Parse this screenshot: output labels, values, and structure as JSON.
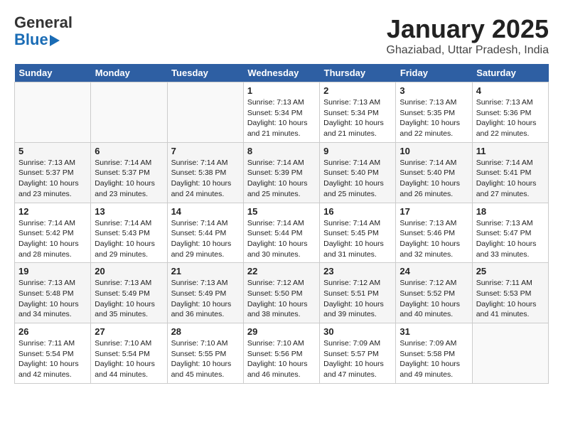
{
  "header": {
    "logo_general": "General",
    "logo_blue": "Blue",
    "month_title": "January 2025",
    "location": "Ghaziabad, Uttar Pradesh, India"
  },
  "days_of_week": [
    "Sunday",
    "Monday",
    "Tuesday",
    "Wednesday",
    "Thursday",
    "Friday",
    "Saturday"
  ],
  "weeks": [
    [
      {
        "day": "",
        "info": ""
      },
      {
        "day": "",
        "info": ""
      },
      {
        "day": "",
        "info": ""
      },
      {
        "day": "1",
        "info": "Sunrise: 7:13 AM\nSunset: 5:34 PM\nDaylight: 10 hours\nand 21 minutes."
      },
      {
        "day": "2",
        "info": "Sunrise: 7:13 AM\nSunset: 5:34 PM\nDaylight: 10 hours\nand 21 minutes."
      },
      {
        "day": "3",
        "info": "Sunrise: 7:13 AM\nSunset: 5:35 PM\nDaylight: 10 hours\nand 22 minutes."
      },
      {
        "day": "4",
        "info": "Sunrise: 7:13 AM\nSunset: 5:36 PM\nDaylight: 10 hours\nand 22 minutes."
      }
    ],
    [
      {
        "day": "5",
        "info": "Sunrise: 7:13 AM\nSunset: 5:37 PM\nDaylight: 10 hours\nand 23 minutes."
      },
      {
        "day": "6",
        "info": "Sunrise: 7:14 AM\nSunset: 5:37 PM\nDaylight: 10 hours\nand 23 minutes."
      },
      {
        "day": "7",
        "info": "Sunrise: 7:14 AM\nSunset: 5:38 PM\nDaylight: 10 hours\nand 24 minutes."
      },
      {
        "day": "8",
        "info": "Sunrise: 7:14 AM\nSunset: 5:39 PM\nDaylight: 10 hours\nand 25 minutes."
      },
      {
        "day": "9",
        "info": "Sunrise: 7:14 AM\nSunset: 5:40 PM\nDaylight: 10 hours\nand 25 minutes."
      },
      {
        "day": "10",
        "info": "Sunrise: 7:14 AM\nSunset: 5:40 PM\nDaylight: 10 hours\nand 26 minutes."
      },
      {
        "day": "11",
        "info": "Sunrise: 7:14 AM\nSunset: 5:41 PM\nDaylight: 10 hours\nand 27 minutes."
      }
    ],
    [
      {
        "day": "12",
        "info": "Sunrise: 7:14 AM\nSunset: 5:42 PM\nDaylight: 10 hours\nand 28 minutes."
      },
      {
        "day": "13",
        "info": "Sunrise: 7:14 AM\nSunset: 5:43 PM\nDaylight: 10 hours\nand 29 minutes."
      },
      {
        "day": "14",
        "info": "Sunrise: 7:14 AM\nSunset: 5:44 PM\nDaylight: 10 hours\nand 29 minutes."
      },
      {
        "day": "15",
        "info": "Sunrise: 7:14 AM\nSunset: 5:44 PM\nDaylight: 10 hours\nand 30 minutes."
      },
      {
        "day": "16",
        "info": "Sunrise: 7:14 AM\nSunset: 5:45 PM\nDaylight: 10 hours\nand 31 minutes."
      },
      {
        "day": "17",
        "info": "Sunrise: 7:13 AM\nSunset: 5:46 PM\nDaylight: 10 hours\nand 32 minutes."
      },
      {
        "day": "18",
        "info": "Sunrise: 7:13 AM\nSunset: 5:47 PM\nDaylight: 10 hours\nand 33 minutes."
      }
    ],
    [
      {
        "day": "19",
        "info": "Sunrise: 7:13 AM\nSunset: 5:48 PM\nDaylight: 10 hours\nand 34 minutes."
      },
      {
        "day": "20",
        "info": "Sunrise: 7:13 AM\nSunset: 5:49 PM\nDaylight: 10 hours\nand 35 minutes."
      },
      {
        "day": "21",
        "info": "Sunrise: 7:13 AM\nSunset: 5:49 PM\nDaylight: 10 hours\nand 36 minutes."
      },
      {
        "day": "22",
        "info": "Sunrise: 7:12 AM\nSunset: 5:50 PM\nDaylight: 10 hours\nand 38 minutes."
      },
      {
        "day": "23",
        "info": "Sunrise: 7:12 AM\nSunset: 5:51 PM\nDaylight: 10 hours\nand 39 minutes."
      },
      {
        "day": "24",
        "info": "Sunrise: 7:12 AM\nSunset: 5:52 PM\nDaylight: 10 hours\nand 40 minutes."
      },
      {
        "day": "25",
        "info": "Sunrise: 7:11 AM\nSunset: 5:53 PM\nDaylight: 10 hours\nand 41 minutes."
      }
    ],
    [
      {
        "day": "26",
        "info": "Sunrise: 7:11 AM\nSunset: 5:54 PM\nDaylight: 10 hours\nand 42 minutes."
      },
      {
        "day": "27",
        "info": "Sunrise: 7:10 AM\nSunset: 5:54 PM\nDaylight: 10 hours\nand 44 minutes."
      },
      {
        "day": "28",
        "info": "Sunrise: 7:10 AM\nSunset: 5:55 PM\nDaylight: 10 hours\nand 45 minutes."
      },
      {
        "day": "29",
        "info": "Sunrise: 7:10 AM\nSunset: 5:56 PM\nDaylight: 10 hours\nand 46 minutes."
      },
      {
        "day": "30",
        "info": "Sunrise: 7:09 AM\nSunset: 5:57 PM\nDaylight: 10 hours\nand 47 minutes."
      },
      {
        "day": "31",
        "info": "Sunrise: 7:09 AM\nSunset: 5:58 PM\nDaylight: 10 hours\nand 49 minutes."
      },
      {
        "day": "",
        "info": ""
      }
    ]
  ]
}
